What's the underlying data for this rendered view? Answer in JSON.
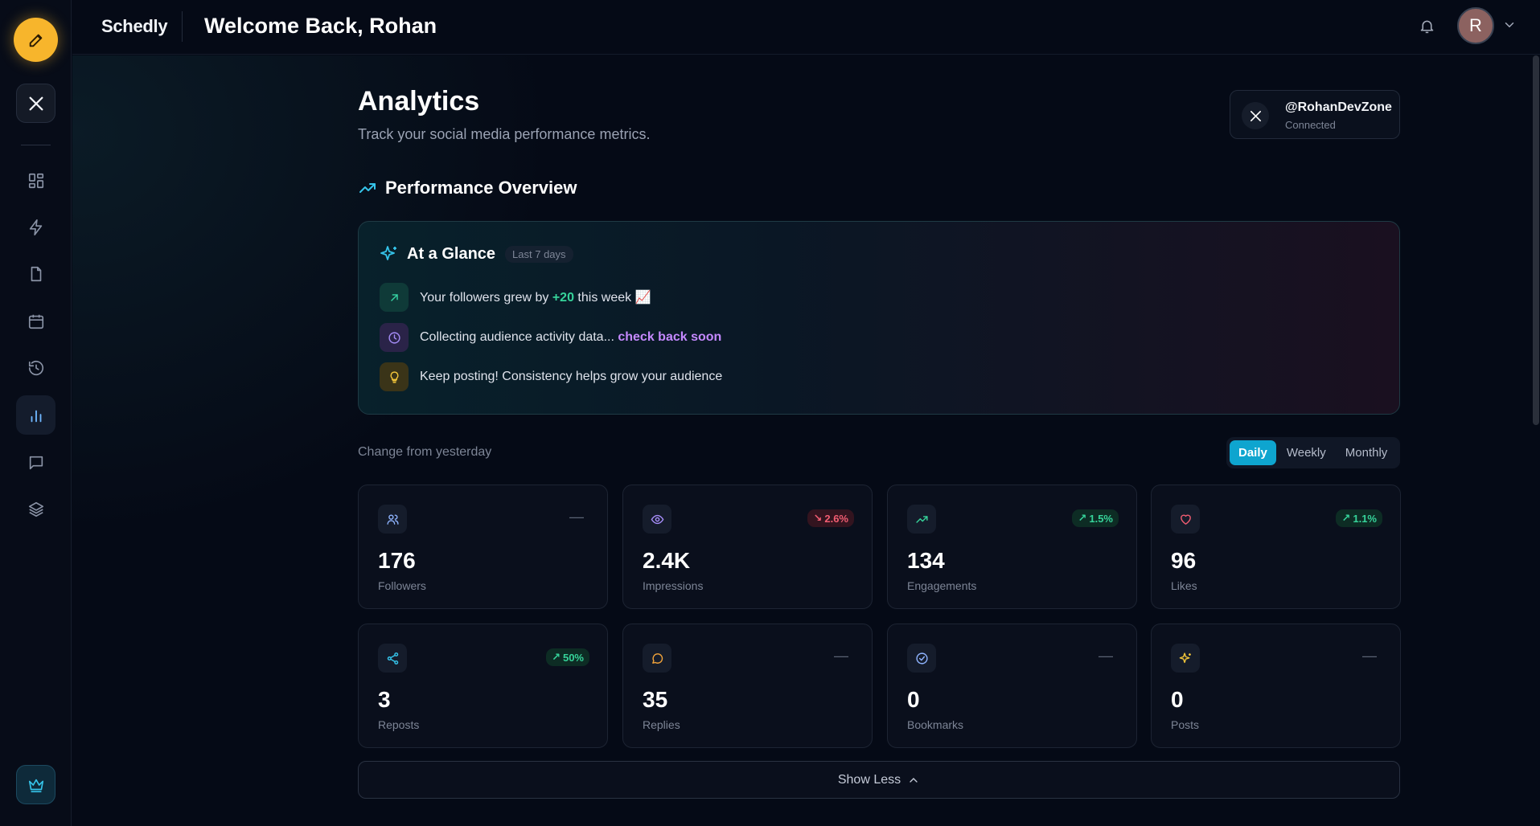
{
  "app": {
    "brand": "Schedly",
    "welcome": "Welcome Back, Rohan"
  },
  "user": {
    "avatar_initial": "R"
  },
  "sidebar": {
    "items": [
      {
        "name": "dashboard",
        "icon": "grid-icon"
      },
      {
        "name": "automation",
        "icon": "bolt-icon"
      },
      {
        "name": "drafts",
        "icon": "file-icon"
      },
      {
        "name": "calendar",
        "icon": "calendar-icon"
      },
      {
        "name": "history",
        "icon": "history-icon"
      },
      {
        "name": "analytics",
        "icon": "bar-chart-icon",
        "active": true
      },
      {
        "name": "messages",
        "icon": "message-icon"
      },
      {
        "name": "layers",
        "icon": "layers-icon"
      }
    ]
  },
  "page": {
    "title": "Analytics",
    "subtitle": "Track your social media performance metrics."
  },
  "account": {
    "handle": "@RohanDevZone",
    "status": "Connected"
  },
  "overview": {
    "title": "Performance Overview"
  },
  "glance": {
    "title": "At a Glance",
    "badge": "Last 7 days",
    "insight1_pre": "Your followers grew by ",
    "insight1_hl": "+20",
    "insight1_post": " this week 📈",
    "insight2_pre": "Collecting audience activity data... ",
    "insight2_hl": "check back soon",
    "insight3": "Keep posting! Consistency helps grow your audience"
  },
  "change_label": "Change from yesterday",
  "period": {
    "options": [
      "Daily",
      "Weekly",
      "Monthly"
    ],
    "selected": "Daily"
  },
  "metrics": [
    {
      "value": "176",
      "label": "Followers",
      "delta": "—",
      "trend": "flat",
      "icon": "users-icon",
      "color": "#8a93a6"
    },
    {
      "value": "2.4K",
      "label": "Impressions",
      "delta": "2.6%",
      "trend": "down",
      "icon": "eye-icon",
      "color": "#a58cf7"
    },
    {
      "value": "134",
      "label": "Engagements",
      "delta": "1.5%",
      "trend": "up",
      "icon": "trending-up-icon",
      "color": "#36d39a"
    },
    {
      "value": "96",
      "label": "Likes",
      "delta": "1.1%",
      "trend": "up",
      "icon": "heart-icon",
      "color": "#f25d72"
    },
    {
      "value": "3",
      "label": "Reposts",
      "delta": "50%",
      "trend": "up",
      "icon": "share-icon",
      "color": "#35c4ea"
    },
    {
      "value": "35",
      "label": "Replies",
      "delta": "—",
      "trend": "flat",
      "icon": "reply-icon",
      "color": "#f0a23a"
    },
    {
      "value": "0",
      "label": "Bookmarks",
      "delta": "—",
      "trend": "flat",
      "icon": "bookmark-icon",
      "color": "#8fb4ff"
    },
    {
      "value": "0",
      "label": "Posts",
      "delta": "—",
      "trend": "flat",
      "icon": "sparkle-icon",
      "color": "#f0c43a"
    }
  ],
  "show_less": "Show Less"
}
